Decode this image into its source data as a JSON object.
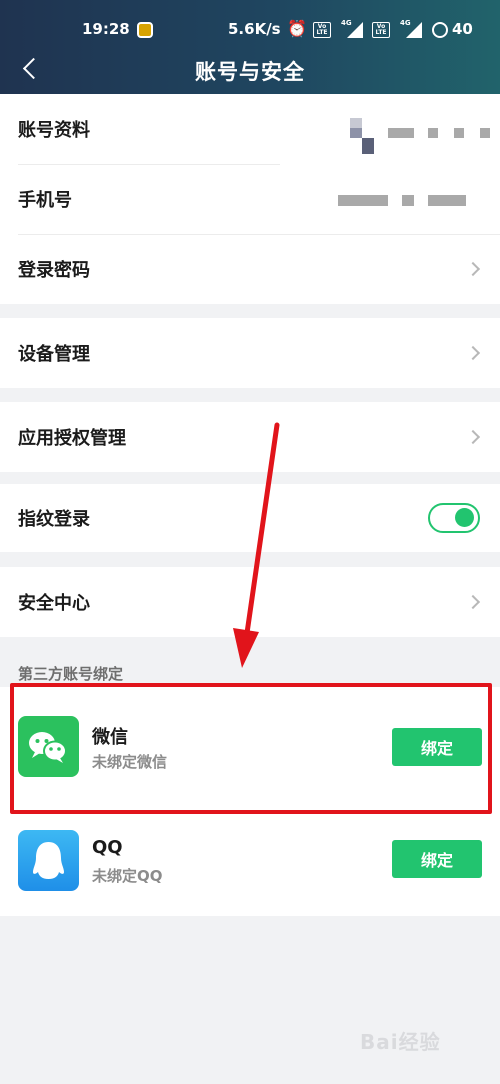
{
  "statusbar": {
    "time": "19:28",
    "netspeed": "5.6K/s",
    "alarm_icon": "alarm-icon",
    "volte_1": "Vo LTE",
    "volte_2": "Vo LTE",
    "net_1": "4G",
    "net_2": "4G",
    "battery": "40"
  },
  "header": {
    "back_icon": "chevron-left-icon",
    "title": "账号与安全"
  },
  "rows": {
    "account_info": "账号资料",
    "phone": "手机号",
    "login_password": "登录密码",
    "device_mgmt": "设备管理",
    "app_auth": "应用授权管理",
    "fingerprint": "指纹登录",
    "security_center": "安全中心"
  },
  "fingerprint_enabled": true,
  "third_party": {
    "section_title": "第三方账号绑定",
    "items": [
      {
        "name": "微信",
        "status": "未绑定微信",
        "button": "绑定",
        "icon": "wechat-icon"
      },
      {
        "name": "QQ",
        "status": "未绑定QQ",
        "button": "绑定",
        "icon": "qq-icon"
      }
    ]
  },
  "colors": {
    "accent": "#22c46f",
    "highlight": "#e1141b",
    "header_start": "#1f3350",
    "header_end": "#21636b"
  },
  "watermark": "Bai经验"
}
